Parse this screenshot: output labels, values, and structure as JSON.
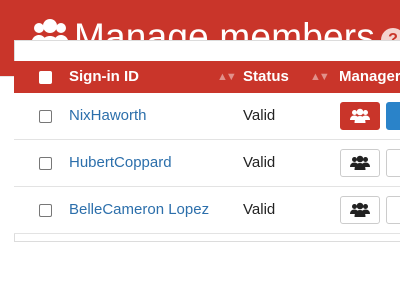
{
  "header": {
    "title": "Manage members",
    "title_icon": "group-icon",
    "help_icon": "help-icon",
    "help_glyph": "?"
  },
  "table": {
    "columns": [
      {
        "label": "Sign-in ID",
        "sortable": true
      },
      {
        "label": "Status",
        "sortable": true
      },
      {
        "label": "Manager"
      }
    ],
    "rows": [
      {
        "sign_in_id": "NixHaworth",
        "status": "Valid",
        "managers_button_active": true
      },
      {
        "sign_in_id": "HubertCoppard",
        "status": "Valid",
        "managers_button_active": false
      },
      {
        "sign_in_id": "BelleCameron Lopez",
        "status": "Valid",
        "managers_button_active": false
      }
    ]
  },
  "colors": {
    "brand": "#c9352a",
    "link": "#2c6fab",
    "accent_blue": "#2a83c9"
  }
}
